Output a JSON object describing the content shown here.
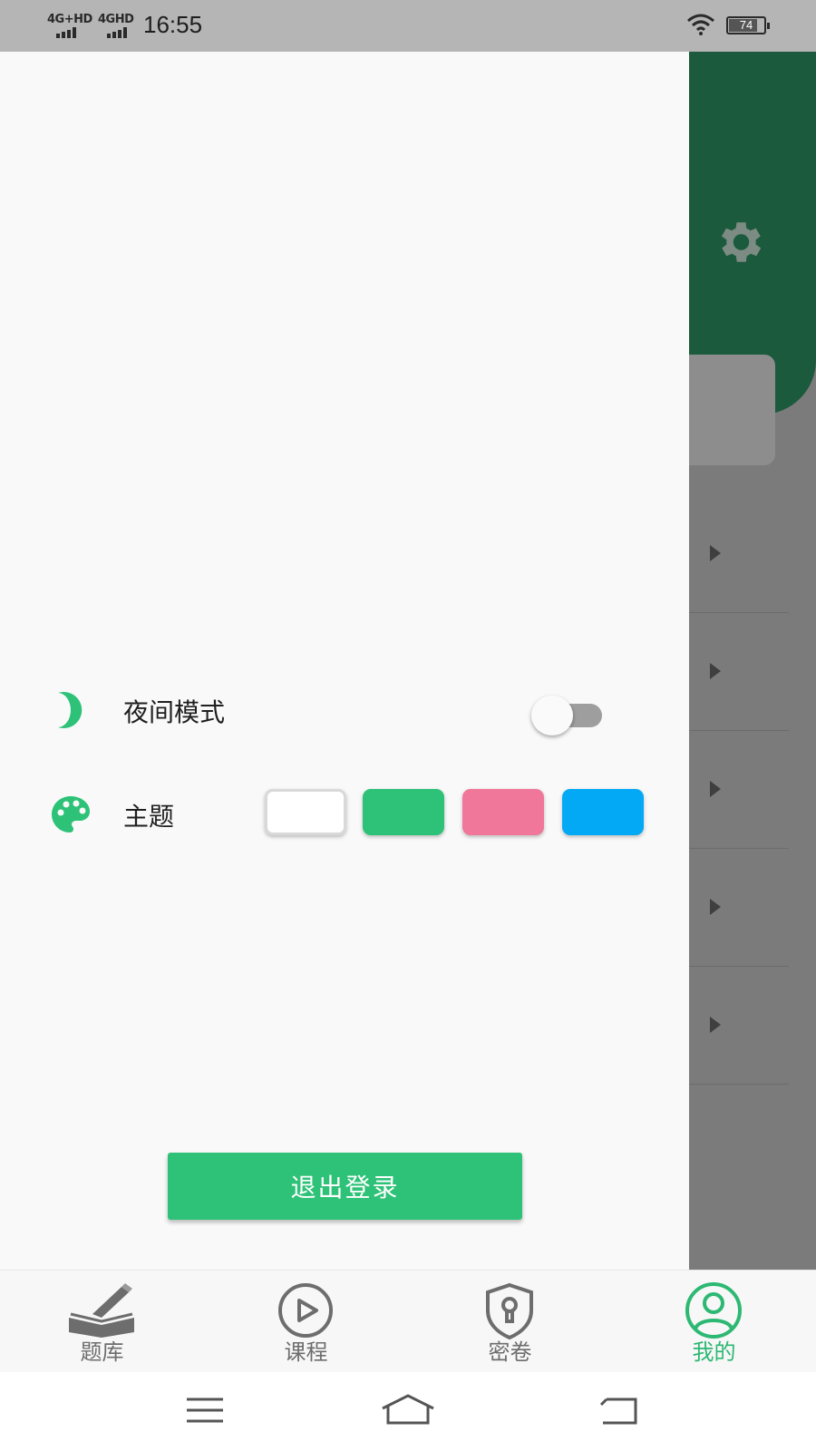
{
  "status_bar": {
    "network1": "4G+HD",
    "network2": "4GHD",
    "time": "16:55",
    "battery": "74",
    "icons": [
      "signal-icon",
      "signal-icon",
      "wifi-icon",
      "battery-icon"
    ]
  },
  "drawer": {
    "night_mode": {
      "label": "夜间模式",
      "enabled": false,
      "icon": "moon-icon"
    },
    "theme": {
      "label": "主题",
      "icon": "palette-icon",
      "colors": [
        "#ffffff",
        "#2dc277",
        "#f0779a",
        "#03a9f4"
      ]
    },
    "logout_label": "退出登录"
  },
  "background_page": {
    "header_color": "#1b5a3c",
    "icons": [
      "gear-icon",
      "arrow-right-icon"
    ]
  },
  "tab_bar": {
    "tabs": [
      {
        "label": "题库",
        "icon": "book-pen-icon"
      },
      {
        "label": "课程",
        "icon": "play-circle-icon"
      },
      {
        "label": "密卷",
        "icon": "shield-lock-icon"
      },
      {
        "label": "我的",
        "icon": "user-circle-icon"
      }
    ],
    "active_color": "#2db873",
    "inactive_color": "#6d6d6d"
  },
  "system_nav": {
    "icons": [
      "menu-icon",
      "home-icon",
      "back-icon"
    ]
  },
  "colors": {
    "accent": "#2dc277"
  }
}
